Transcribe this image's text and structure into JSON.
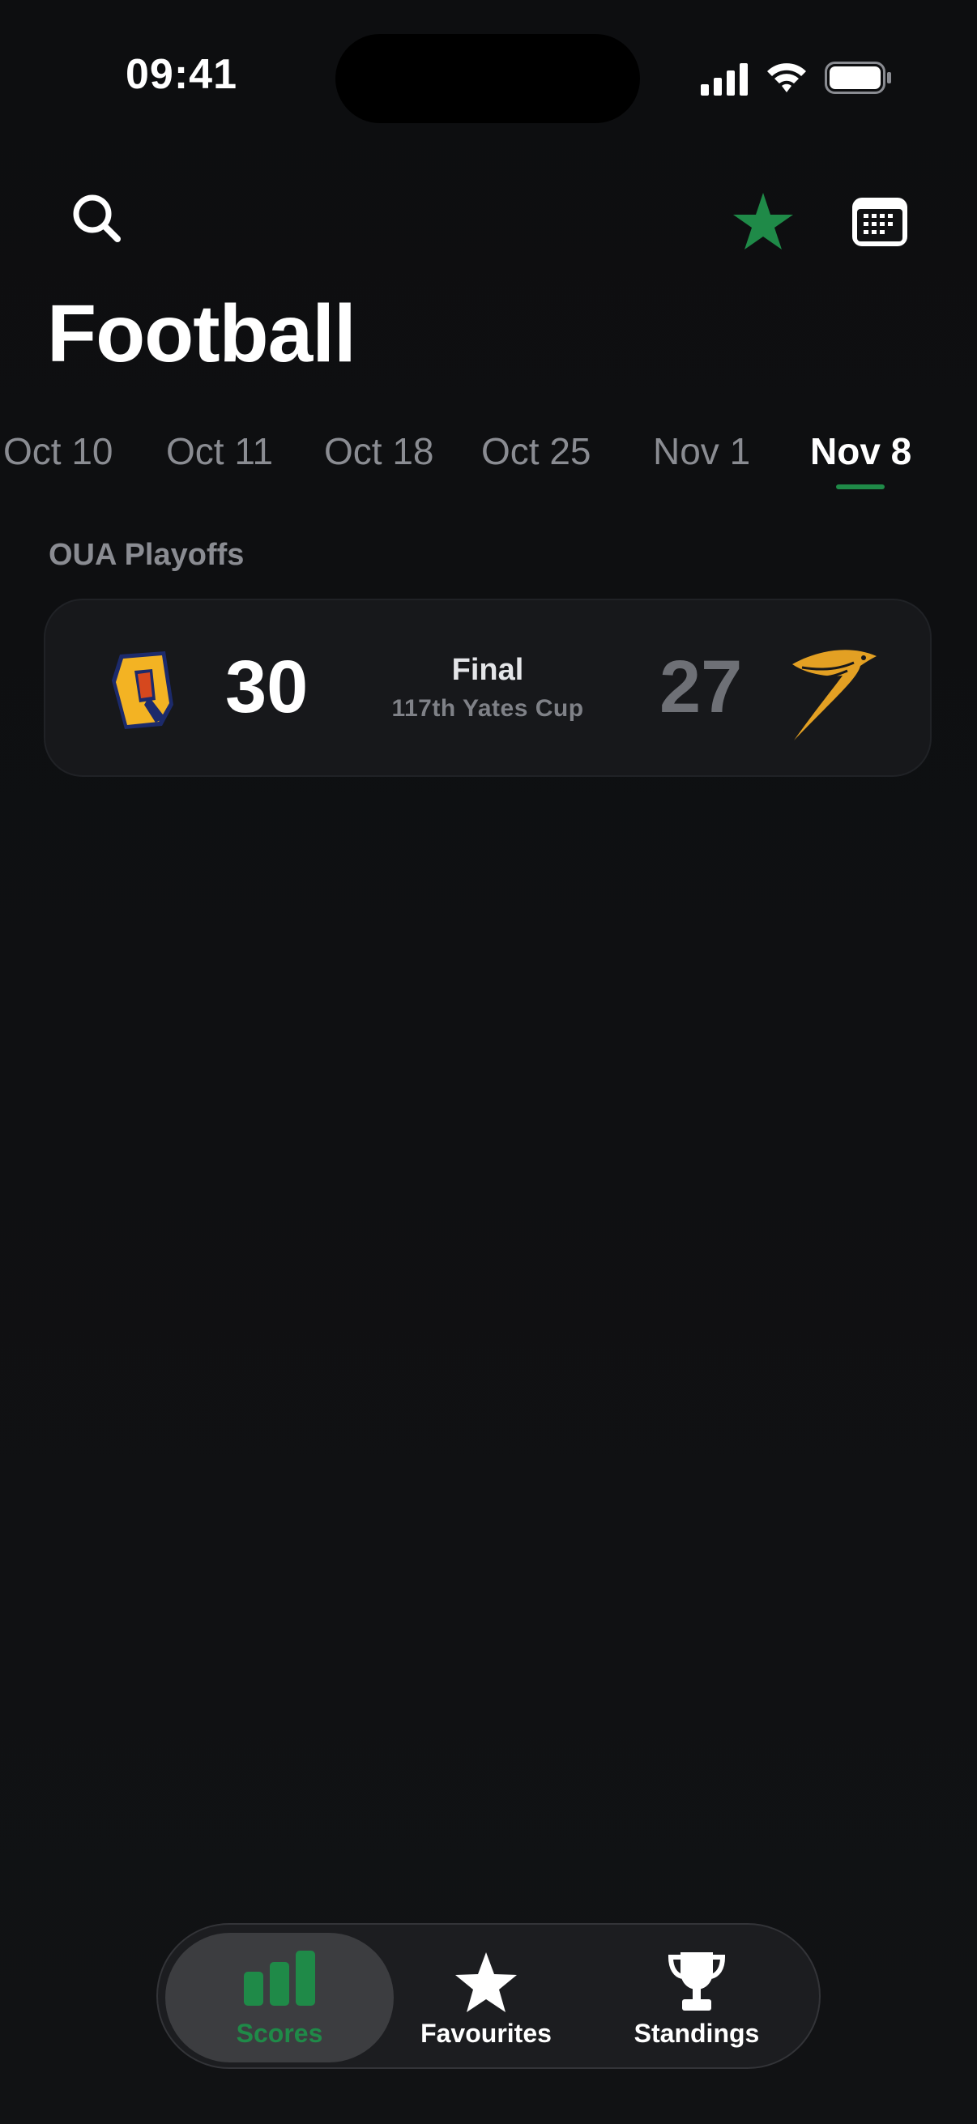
{
  "status_bar": {
    "time": "09:41"
  },
  "page": {
    "title": "Football"
  },
  "date_tabs": [
    {
      "label": "Oct 10",
      "active": false
    },
    {
      "label": "Oct 11",
      "active": false
    },
    {
      "label": "Oct 18",
      "active": false
    },
    {
      "label": "Oct 25",
      "active": false
    },
    {
      "label": "Nov 1",
      "active": false
    },
    {
      "label": "Nov 8",
      "active": true
    }
  ],
  "section": {
    "label": "OUA Playoffs"
  },
  "game": {
    "home_score": "30",
    "away_score": "27",
    "status": "Final",
    "subtitle": "117th Yates Cup",
    "home_logo_icon": "queens-q-logo-icon",
    "away_logo_icon": "golden-hawk-logo-icon"
  },
  "bottom_nav": {
    "scores": "Scores",
    "favourites": "Favourites",
    "standings": "Standings"
  },
  "colors": {
    "accent": "#1f8a48",
    "background": "#0d0e10",
    "card": "#17181b"
  }
}
